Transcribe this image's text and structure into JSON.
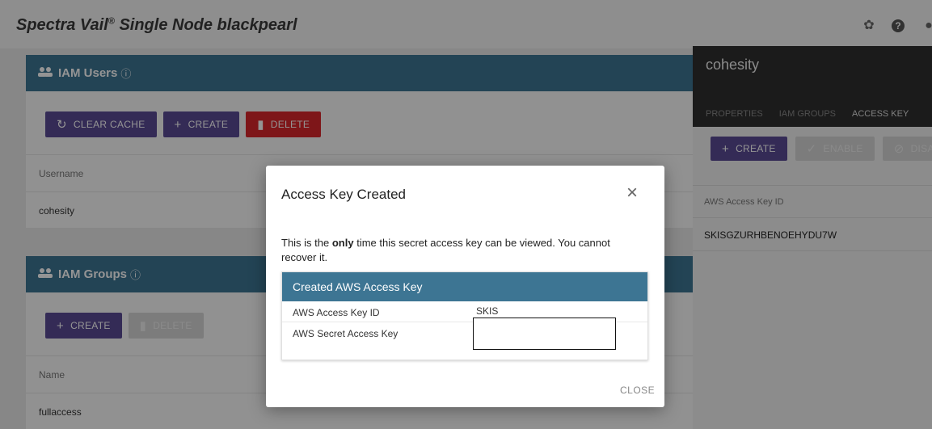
{
  "header": {
    "title": "Spectra Vail",
    "registered_mark": "®",
    "title_suffix": "Single Node blackpearl"
  },
  "iam_users": {
    "heading": "IAM Users",
    "buttons": {
      "clear_cache": "CLEAR CACHE",
      "create": "CREATE",
      "delete": "DELETE"
    },
    "column": "Username",
    "rows": [
      "cohesity"
    ]
  },
  "iam_groups": {
    "heading": "IAM Groups",
    "buttons": {
      "create": "CREATE",
      "delete": "DELETE"
    },
    "column": "Name",
    "rows": [
      "fullaccess"
    ]
  },
  "side_panel": {
    "title": "cohesity",
    "tabs": [
      "PROPERTIES",
      "IAM GROUPS",
      "ACCESS KEY"
    ],
    "buttons": {
      "create": "CREATE",
      "enable": "ENABLE",
      "disable": "DISAI"
    },
    "column": "AWS Access Key ID",
    "rows": [
      "SKISGZURHBENOEHYDU7W"
    ]
  },
  "dialog": {
    "title": "Access Key Created",
    "message_before": "This is the ",
    "message_emphasis": "only",
    "message_after": " time this secret access key can be viewed. You cannot recover it.",
    "card_title": "Created AWS Access Key",
    "key_id_label": "AWS Access Key ID",
    "key_id_value": "SKIS",
    "secret_label": "AWS Secret Access Key",
    "close_label": "CLOSE"
  }
}
